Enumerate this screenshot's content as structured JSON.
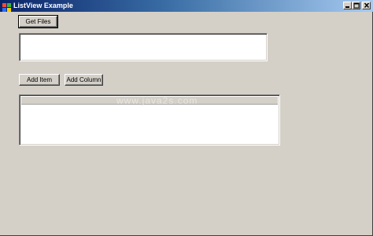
{
  "window": {
    "title": "ListView Example"
  },
  "buttons": {
    "get_files": "Get Files",
    "add_item": "Add Item",
    "add_column": "Add Column"
  },
  "watermark": "www.java2s.com",
  "icons": {
    "app": "app-icon",
    "minimize": "minimize-icon",
    "maximize": "maximize-icon",
    "close": "close-icon"
  }
}
